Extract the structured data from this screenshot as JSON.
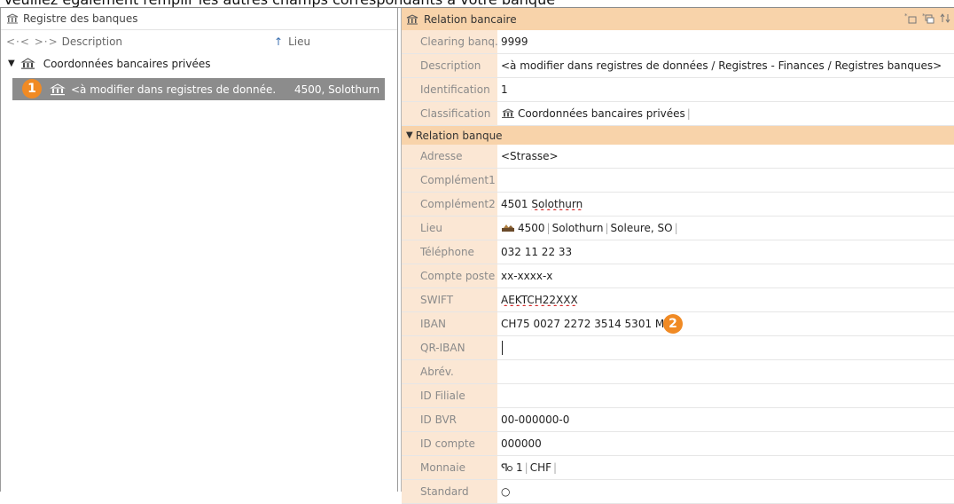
{
  "caption": "Veuillez également remplir les autres champs correspondants à votre banque",
  "left": {
    "title": "Registre des banques",
    "nav": "<·< >·>",
    "col_description": "Description",
    "col_lieu": "Lieu",
    "sort_glyph": "↑",
    "group": "Coordonnées bancaires privées",
    "row": {
      "description": "<à modifier dans registres de donnée.",
      "lieu": "4500, Solothurn"
    },
    "badge": "1"
  },
  "right": {
    "title": "Relation bancaire",
    "tool_icons": [
      "new-record-icon",
      "copy-record-icon",
      "swap-icon"
    ],
    "fields": {
      "clearing": {
        "label": "Clearing banq.",
        "value": "9999"
      },
      "description": {
        "label": "Description",
        "value": "<à modifier dans registres de données / Registres - Finances / Registres banques>"
      },
      "identification": {
        "label": "Identification",
        "value": "1"
      },
      "classification": {
        "label": "Classification",
        "value": "Coordonnées bancaires privées"
      }
    },
    "section": "Relation banque",
    "relation": {
      "adresse": {
        "label": "Adresse",
        "value": "<Strasse>"
      },
      "complement1": {
        "label": "Complément1",
        "value": ""
      },
      "complement2": {
        "label": "Complément2",
        "value_prefix": "4501 ",
        "value_ul": "Solothurn"
      },
      "lieu": {
        "label": "Lieu",
        "parts": [
          "4500",
          "Solothurn",
          "Soleure, SO"
        ]
      },
      "telephone": {
        "label": "Téléphone",
        "value": "032 11 22 33"
      },
      "compte_poste": {
        "label": "Compte poste",
        "value": "xx-xxxx-x"
      },
      "swift": {
        "label": "SWIFT",
        "value": "AEKTCH22XXX"
      },
      "iban": {
        "label": "IBAN",
        "value": "CH75 0027 2272 3514 5301 M"
      },
      "qr_iban": {
        "label": "QR-IBAN",
        "value": ""
      },
      "abrev": {
        "label": "Abrév.",
        "value": ""
      },
      "id_filiale": {
        "label": "ID Filiale",
        "value": ""
      },
      "id_bvr": {
        "label": "ID BVR",
        "value": "00-000000-0"
      },
      "id_compte": {
        "label": "ID compte",
        "value": "000000"
      },
      "monnaie": {
        "label": "Monnaie",
        "parts": [
          "1",
          "CHF"
        ]
      },
      "standard": {
        "label": "Standard",
        "value": "○"
      }
    },
    "badge": "2"
  },
  "colors": {
    "accent_header": "#f8d3aa",
    "label_bg": "#fbe7d4",
    "badge": "#f08a24",
    "selection": "#8c8c8c"
  }
}
